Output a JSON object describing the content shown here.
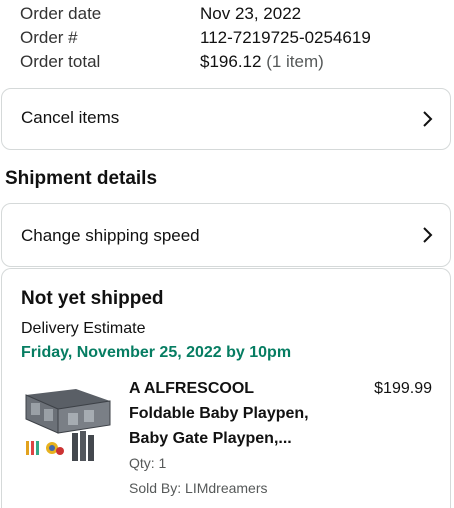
{
  "order_summary": {
    "date_label": "Order date",
    "date_value": "Nov 23, 2022",
    "number_label": "Order #",
    "number_value": "112-7219725-0254619",
    "total_label": "Order total",
    "total_value": "$196.12",
    "total_items": "(1 item)"
  },
  "cancel_card": {
    "label": "Cancel items"
  },
  "shipment": {
    "section_title": "Shipment details",
    "change_speed_label": "Change shipping speed",
    "status": "Not yet shipped",
    "delivery_label": "Delivery Estimate",
    "delivery_date": "Friday, November 25, 2022 by 10pm",
    "item": {
      "title_lines": [
        "A ALFRESCOOL",
        "Foldable Baby Playpen,",
        "Baby Gate Playpen,..."
      ],
      "price": "$199.99",
      "qty": "Qty: 1",
      "sold_by": "Sold By: LIMdreamers",
      "image_icon": "baby-playpen-image"
    }
  },
  "colors": {
    "delivery_green": "#067d62",
    "border": "#d5d9d9",
    "muted_text": "#565959"
  }
}
